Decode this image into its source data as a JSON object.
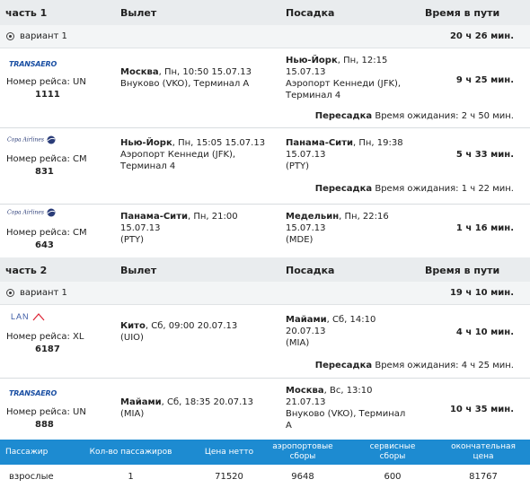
{
  "part1": {
    "title": "часть 1",
    "dep": "Вылет",
    "arr": "Посадка",
    "time": "Время в пути",
    "variant": "вариант 1",
    "total": "20 ч 26 мин.",
    "segments": [
      {
        "airline": "TRANSAERO",
        "flight_label": "Номер рейса: UN",
        "flight_no": "1111",
        "dep_city": "Москва",
        "dep_rest": ", Пн, 10:50 15.07.13",
        "dep_airport": "Внуково (VKO), Терминал A",
        "arr_city": "Нью-Йорк",
        "arr_rest": ", Пн, 12:15",
        "arr_date": "15.07.13",
        "arr_airport": "Аэропорт Кеннеди (JFK),",
        "arr_term": "Терминал 4",
        "duration": "9 ч 25 мин.",
        "transfer": "Пересадка",
        "wait": "Время ожидания: 2 ч 50 мин."
      },
      {
        "airline": "Copa Airlines",
        "flight_label": "Номер рейса: CM",
        "flight_no": "831",
        "dep_city": "Нью-Йорк",
        "dep_rest": ", Пн, 15:05 15.07.13",
        "dep_airport": "Аэропорт Кеннеди (JFK),",
        "dep_term": "Терминал 4",
        "arr_city": "Панама-Сити",
        "arr_rest": ", Пн, 19:38",
        "arr_date": "15.07.13",
        "arr_airport": "(PTY)",
        "duration": "5 ч 33 мин.",
        "transfer": "Пересадка",
        "wait": "Время ожидания: 1 ч 22 мин."
      },
      {
        "airline": "Copa Airlines",
        "flight_label": "Номер рейса: CM",
        "flight_no": "643",
        "dep_city": "Панама-Сити",
        "dep_rest": ", Пн, 21:00",
        "dep_date": "15.07.13",
        "dep_airport": "(PTY)",
        "arr_city": "Медельин",
        "arr_rest": ", Пн, 22:16",
        "arr_date": "15.07.13",
        "arr_airport": "(MDE)",
        "duration": "1 ч 16 мин."
      }
    ]
  },
  "part2": {
    "title": "часть 2",
    "dep": "Вылет",
    "arr": "Посадка",
    "time": "Время в пути",
    "variant": "вариант 1",
    "total": "19 ч 10 мин.",
    "segments": [
      {
        "airline": "LAN",
        "flight_label": "Номер рейса: XL",
        "flight_no": "6187",
        "dep_city": "Кито",
        "dep_rest": ", Сб, 09:00 20.07.13",
        "dep_airport": "(UIO)",
        "arr_city": "Майами",
        "arr_rest": ", Сб, 14:10",
        "arr_date": "20.07.13",
        "arr_airport": "(MIA)",
        "duration": "4 ч 10 мин.",
        "transfer": "Пересадка",
        "wait": "Время ожидания: 4 ч 25 мин."
      },
      {
        "airline": "TRANSAERO",
        "flight_label": "Номер рейса: UN",
        "flight_no": "888",
        "dep_city": "Майами",
        "dep_rest": ", Сб, 18:35 20.07.13",
        "dep_airport": "(MIA)",
        "arr_city": "Москва",
        "arr_rest": ", Вс, 13:10",
        "arr_date": "21.07.13",
        "arr_airport": "Внуково (VKO), Терминал",
        "arr_term": "A",
        "duration": "10 ч 35 мин."
      }
    ]
  },
  "footer": {
    "headers": [
      "Пассажир",
      "Кол-во пассажиров",
      "Цена нетто",
      "аэропортовые\nсборы",
      "сервисные\nсборы",
      "окончательная\nцена"
    ],
    "row": [
      "взрослые",
      "1",
      "71520",
      "9648",
      "600",
      "81767"
    ]
  },
  "colors": {
    "footer_bg": "#1d8bd1",
    "header_bg": "#e9ecee",
    "logo_blue": "#1a4fa3"
  }
}
